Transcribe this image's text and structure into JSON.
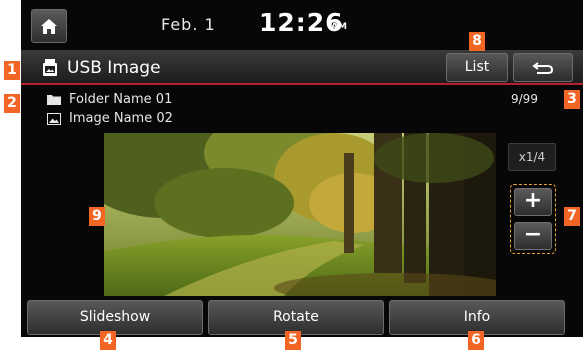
{
  "status": {
    "date": "Feb.  1",
    "time": "12:26",
    "ampm": "AM"
  },
  "title_bar": {
    "title": "USB Image",
    "list_label": "List"
  },
  "path": {
    "folder": "Folder Name 01",
    "image": "Image Name 02",
    "counter": "9/99"
  },
  "viewer": {
    "zoom_level": "x1/4",
    "zoom_in": "+",
    "zoom_out": "−"
  },
  "bottom_bar": {
    "slideshow": "Slideshow",
    "rotate": "Rotate",
    "info": "Info"
  },
  "callouts": [
    "1",
    "2",
    "3",
    "4",
    "5",
    "6",
    "7",
    "8",
    "9"
  ],
  "colors": {
    "accent_line": "#b8202e",
    "callout": "#f26522",
    "zoom_outline": "#e9a23b"
  }
}
